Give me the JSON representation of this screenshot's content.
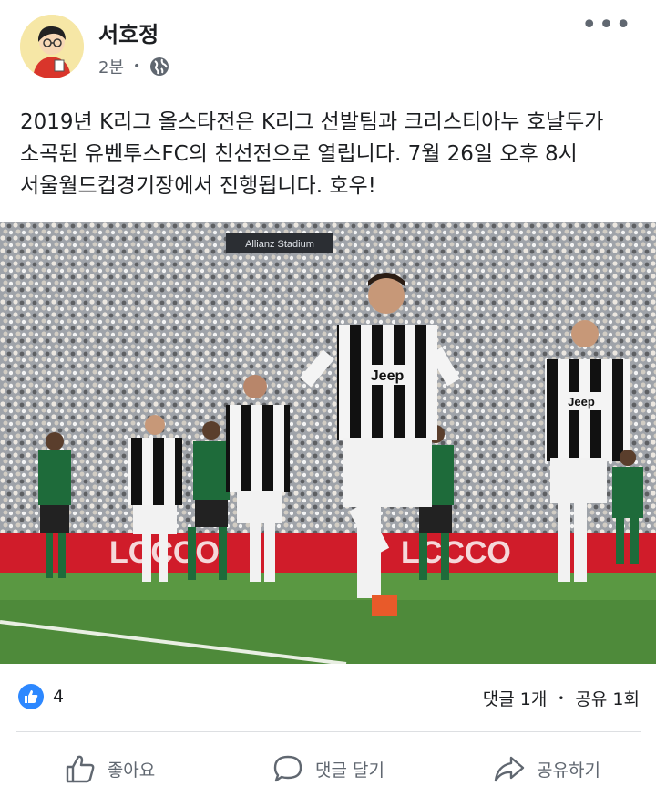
{
  "post": {
    "author": "서호정",
    "time": "2분",
    "separator": "•",
    "more_label": "•••",
    "text": "2019년 K리그 올스타전은 K리그 선발팀과 크리스티아누 호날두가\n소곡된 유벤투스FC의 친선전으로 열립니다. 7월 26일 오후 8시\n서울월드컵경기장에서 진행됩니다. 호우!",
    "photo": {
      "stadium_sign": "Allianz Stadium",
      "jersey_sponsor": "Jeep",
      "board_text": "LCCCO",
      "colors": {
        "home": "#111111",
        "home_alt": "#ffffff",
        "away": "#1e6b3a",
        "pitch": "#4e8a3a",
        "board": "#d01c2a"
      }
    }
  },
  "stats": {
    "reaction_count": "4",
    "comments": "댓글 1개",
    "dot": "•",
    "shares": "공유 1회"
  },
  "actions": {
    "like": "좋아요",
    "comment": "댓글 달기",
    "share": "공유하기"
  },
  "colors": {
    "accent": "#2d88ff",
    "secondary_text": "#606770",
    "divider": "#dddfe2"
  },
  "icons": [
    "globe-icon",
    "more-icon",
    "like-reaction-icon",
    "like-thumb-icon",
    "comment-icon",
    "share-icon"
  ]
}
